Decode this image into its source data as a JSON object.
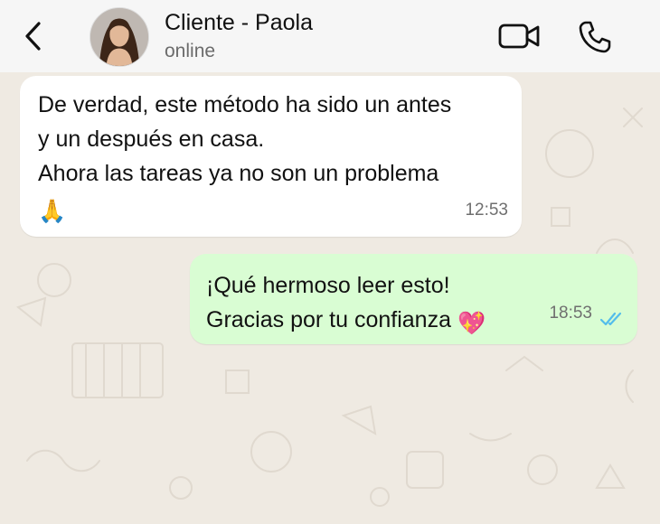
{
  "header": {
    "contact_name": "Cliente - Paola",
    "status": "online",
    "icons": [
      "back-chevron-icon",
      "video-call-icon",
      "phone-call-icon"
    ]
  },
  "messages": [
    {
      "direction": "incoming",
      "lines": [
        "De verdad, este método ha sido un antes",
        "y un después en casa.",
        "Ahora las tareas ya no son un problema"
      ],
      "emoji": "🙏",
      "time": "12:53"
    },
    {
      "direction": "outgoing",
      "lines": [
        "¡Qué hermoso leer esto!",
        "Gracias por tu confianza"
      ],
      "emoji": "💖",
      "time": "18:53",
      "read_receipt": "double-check-blue"
    }
  ],
  "colors": {
    "chat_background": "#efeae2",
    "incoming_bubble": "#ffffff",
    "outgoing_bubble": "#d9fdd3",
    "read_ticks": "#53bdeb"
  }
}
